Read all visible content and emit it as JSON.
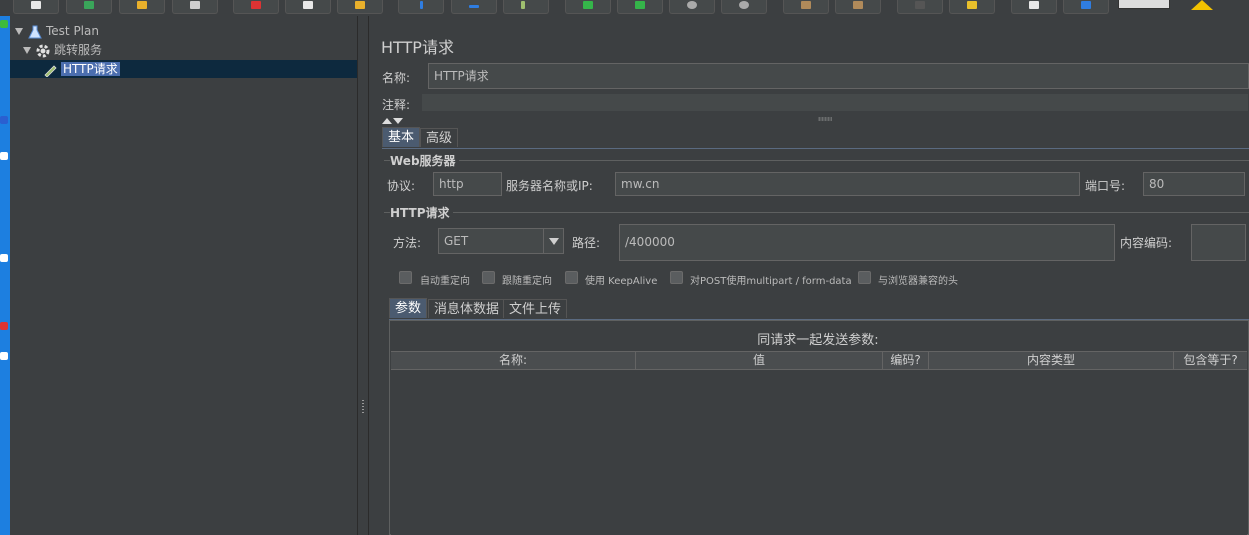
{
  "tree": {
    "root_label": "Test Plan",
    "group_label": "跳转服务",
    "sampler_label": "HTTP请求"
  },
  "panel": {
    "title": "HTTP请求",
    "name_label": "名称:",
    "name_value": "HTTP请求",
    "comment_label": "注释:",
    "comment_value": "",
    "tabs": [
      "基本",
      "高级"
    ],
    "web_server": {
      "title": "Web服务器",
      "protocol_label": "协议:",
      "protocol_value": "http",
      "server_label": "服务器名称或IP:",
      "server_value": "mw.cn",
      "port_label": "端口号:",
      "port_value": "80"
    },
    "http_request": {
      "title": "HTTP请求",
      "method_label": "方法:",
      "method_value": "GET",
      "path_label": "路径:",
      "path_value": "/400000",
      "encoding_label": "内容编码:",
      "encoding_value": ""
    },
    "options": [
      {
        "label": "自动重定向",
        "checked": false
      },
      {
        "label": "跟随重定向",
        "checked": false
      },
      {
        "label": "使用 KeepAlive",
        "checked": false
      },
      {
        "label": "对POST使用multipart / form-data",
        "checked": false
      },
      {
        "label": "与浏览器兼容的头",
        "checked": false
      }
    ],
    "sub_tabs": [
      "参数",
      "消息体数据",
      "文件上传"
    ],
    "params_caption": "同请求一起发送参数:",
    "columns": [
      "名称:",
      "值",
      "编码?",
      "内容类型",
      "包含等于?"
    ]
  },
  "colors": {
    "background": "#3c3f41",
    "selection": "#4b6eaf",
    "active_tab": "#4b5b70"
  },
  "icons": [
    "new-icon",
    "template-icon",
    "open-icon",
    "save-icon",
    "cut-icon",
    "copy-icon",
    "paste-icon",
    "expand-icon",
    "collapse-icon",
    "toggle-icon",
    "start-icon",
    "start-no-pause-icon",
    "stop-icon",
    "shutdown-icon",
    "clear-icon",
    "clear-all-icon",
    "search-icon",
    "reset-search-icon",
    "function-helper-icon",
    "help-icon",
    "warning-icon"
  ]
}
